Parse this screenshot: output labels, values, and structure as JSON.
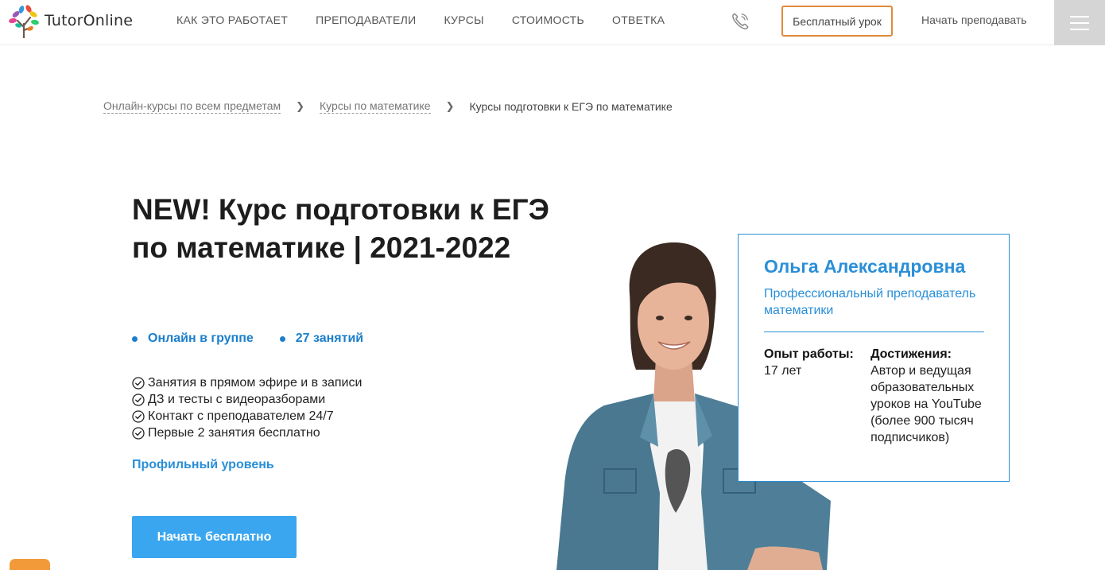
{
  "header": {
    "logo_text": "TutorOnline",
    "logo_icon": "tree-logo-icon",
    "nav": [
      {
        "label": "КАК ЭТО РАБОТАЕТ"
      },
      {
        "label": "ПРЕПОДАВАТЕЛИ"
      },
      {
        "label": "КУРСЫ"
      },
      {
        "label": "СТОИМОСТЬ"
      },
      {
        "label": "ОТВЕТКА"
      }
    ],
    "phone_icon": "phone-icon",
    "free_lesson_label": "Бесплатный урок",
    "teach_label": "Начать преподавать",
    "menu_icon": "hamburger-icon"
  },
  "breadcrumb": {
    "items": [
      {
        "label": "Онлайн-курсы по всем предметам"
      },
      {
        "label": "Курсы по математике"
      }
    ],
    "separator": "❯",
    "current": "Курсы подготовки к ЕГЭ по математике"
  },
  "hero": {
    "title": "NEW! Курс подготовки к ЕГЭ по математике | 2021-2022",
    "tags": [
      {
        "label": "Онлайн в группе"
      },
      {
        "label": "27 занятий"
      }
    ],
    "features": [
      {
        "label": "Занятия в прямом эфире и в записи"
      },
      {
        "label": "ДЗ и тесты с видеоразборами"
      },
      {
        "label": "Контакт с преподавателем 24/7"
      },
      {
        "label": "Первые 2 занятия бесплатно"
      }
    ],
    "level_label": "Профильный уровень",
    "start_button": "Начать бесплатно"
  },
  "teacher": {
    "name": "Ольга Александровна",
    "role": "Профессиональный преподаватель математики",
    "experience_label": "Опыт работы:",
    "experience_value": "17 лет",
    "achievements_label": "Достижения:",
    "achievements_value": "Автор и ведущая образовательных уроков на YouTube (более 900 тысяч подписчиков)"
  },
  "colors": {
    "accent_blue": "#2a8fd8",
    "button_blue": "#3aa6ef",
    "accent_orange": "#e08a3a"
  }
}
